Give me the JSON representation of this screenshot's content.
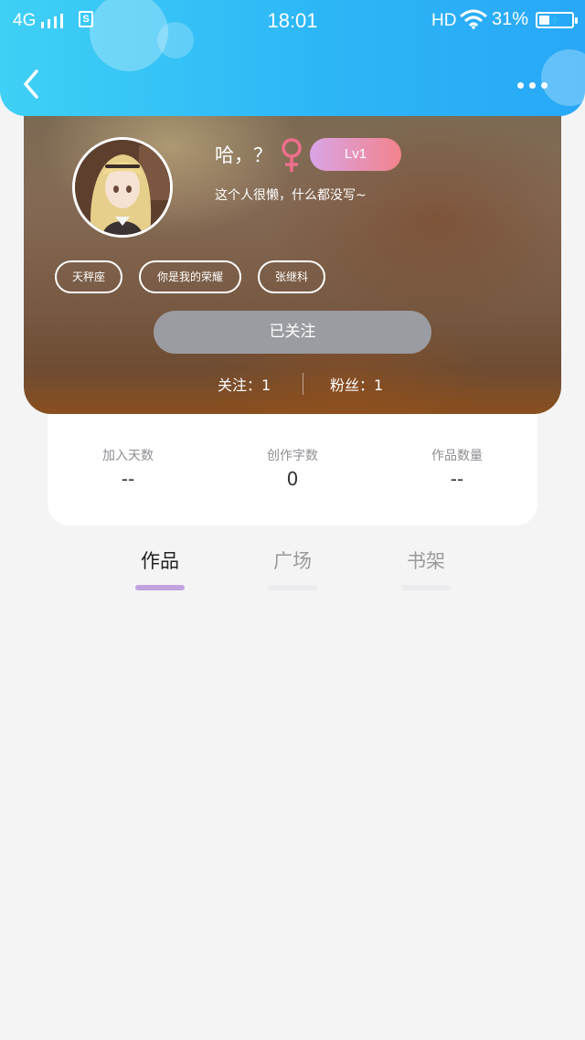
{
  "status_bar": {
    "network": "4G",
    "sim_badge": "S",
    "time": "18:01",
    "hd": "HD",
    "battery": "31%",
    "battery_level": 0.31
  },
  "header": {
    "back_icon": "chevron-left-icon",
    "more_icon": "more-horizontal-icon"
  },
  "profile": {
    "nickname": "哈，？",
    "gender": "female",
    "gender_color": "#ee6f8b",
    "level": "Lv1",
    "bio": "这个人很懒，什么都没写~",
    "tags": [
      "天秤座",
      "你是我的荣耀",
      "张继科"
    ],
    "follow_button": "已关注",
    "following_label": "关注：1",
    "followers_label": "粉丝：1"
  },
  "stats": [
    {
      "label": "加入天数",
      "value": "--"
    },
    {
      "label": "创作字数",
      "value": "0"
    },
    {
      "label": "作品数量",
      "value": "--"
    }
  ],
  "tabs": [
    {
      "label": "作品",
      "active": true
    },
    {
      "label": "广场",
      "active": false
    },
    {
      "label": "书架",
      "active": false
    }
  ],
  "colors": {
    "header_start": "#3fd0f5",
    "header_end": "#28a8f7",
    "tab_indicator_active": "#c3a3de",
    "follow_button": "#9b9ca1",
    "level_badge_start": "#d9a4e6",
    "level_badge_end": "#f2838c"
  }
}
